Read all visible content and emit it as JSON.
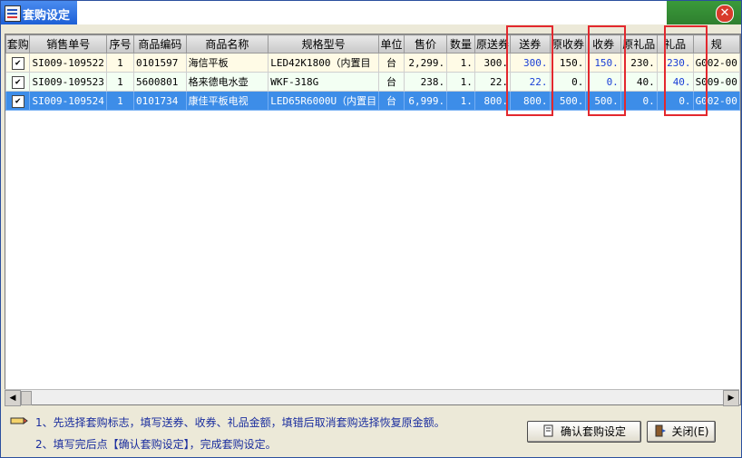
{
  "window": {
    "title": "套购设定",
    "close": "✕"
  },
  "columns": [
    "套购",
    "销售单号",
    "序号",
    "商品编码",
    "商品名称",
    "规格型号",
    "单位",
    "售价",
    "数量",
    "原送券",
    "送券",
    "原收券",
    "收券",
    "原礼品",
    "礼品",
    "规"
  ],
  "rows": [
    {
      "checked": "✔",
      "order": "SI009-109522",
      "seq": "1",
      "code": "0101597",
      "name": "海信平板",
      "model": "LED42K1800（内置目",
      "unit": "台",
      "price": "2,299.",
      "qty": "1.",
      "orig_send": "300.",
      "send": "300.",
      "orig_recv": "150.",
      "recv": "150.",
      "orig_gift": "230.",
      "gift": "230.",
      "extra": "G002-00"
    },
    {
      "checked": "✔",
      "order": "SI009-109523",
      "seq": "1",
      "code": "5600801",
      "name": "格来德电水壶",
      "model": "WKF-318G",
      "unit": "台",
      "price": "238.",
      "qty": "1.",
      "orig_send": "22.",
      "send": "22.",
      "orig_recv": "0.",
      "recv": "0.",
      "orig_gift": "40.",
      "gift": "40.",
      "extra": "S009-00"
    },
    {
      "checked": "✔",
      "order": "SI009-109524",
      "seq": "1",
      "code": "0101734",
      "name": "康佳平板电视",
      "model": "LED65R6000U（内置目",
      "unit": "台",
      "price": "6,999.",
      "qty": "1.",
      "orig_send": "800.",
      "send": "800.",
      "orig_recv": "500.",
      "recv": "500.",
      "orig_gift": "0.",
      "gift": "0.",
      "extra": "G002-00"
    }
  ],
  "notes": {
    "line1": "1、先选择套购标志，填写送券、收券、礼品金额，填错后取消套购选择恢复原金额。",
    "line2": "2、填写完后点【确认套购设定】，完成套购设定。"
  },
  "buttons": {
    "confirm": "确认套购设定",
    "close": "关闭(E)"
  },
  "scroll": {
    "left": "◀",
    "right": "▶"
  },
  "colors": {
    "highlight_box": "#e3282e",
    "selected_row": "#3d8de8",
    "accent_text": "#1a3fd6"
  }
}
